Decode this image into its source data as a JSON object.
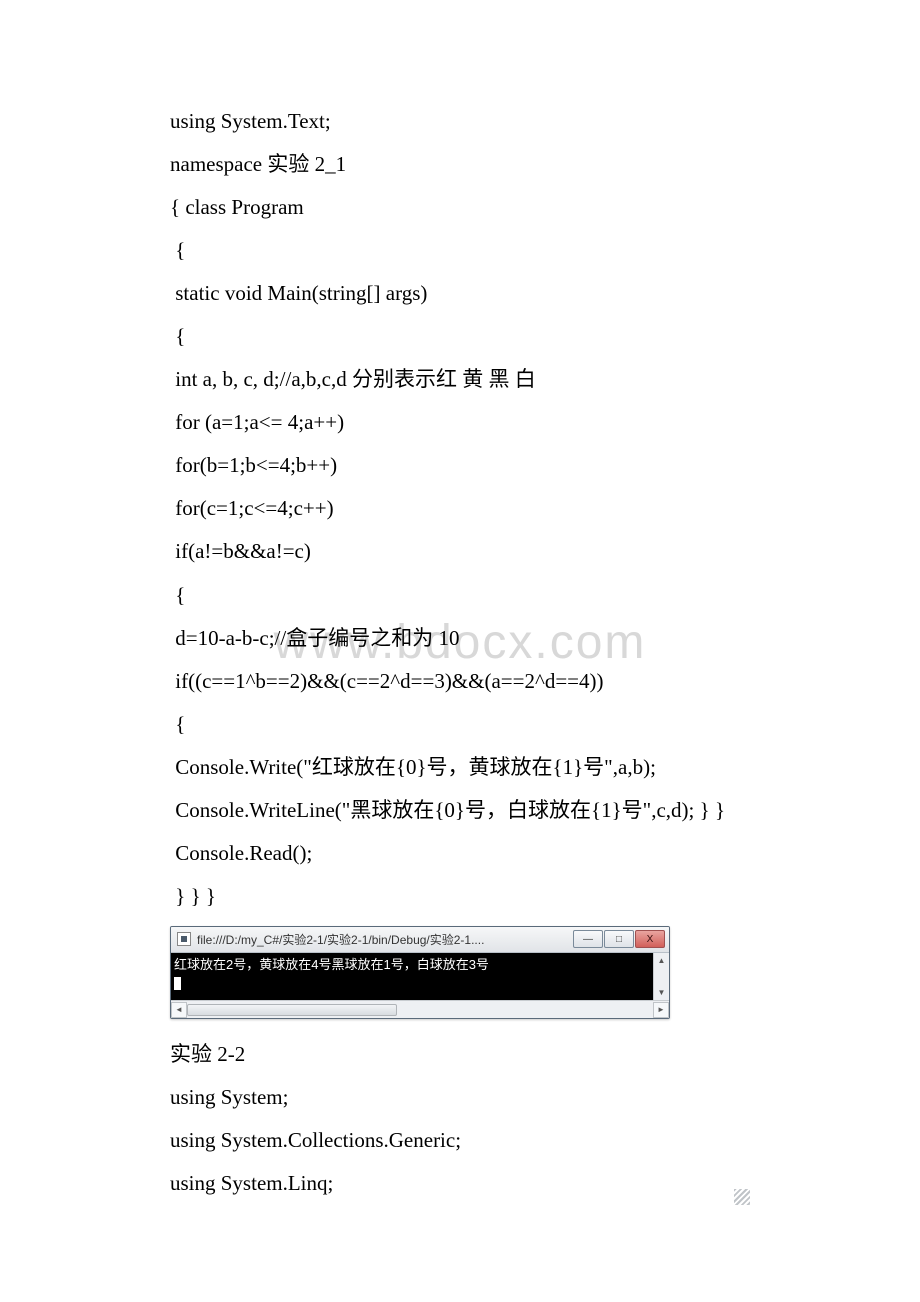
{
  "watermark": "www.bdocx.com",
  "code_block_1": [
    "using System.Text;",
    "namespace 实验 2_1",
    "{ class Program",
    " {",
    " static void Main(string[] args)",
    " {",
    " int a, b, c, d;//a,b,c,d 分别表示红 黄 黑 白",
    " for (a=1;a<= 4;a++)",
    " for(b=1;b<=4;b++)",
    " for(c=1;c<=4;c++)",
    " if(a!=b&&a!=c)",
    " {",
    " d=10-a-b-c;//盒子编号之和为 10",
    " if((c==1^b==2)&&(c==2^d==3)&&(a==2^d==4))",
    " {",
    " Console.Write(\"红球放在{0}号，黄球放在{1}号\",a,b);",
    " Console.WriteLine(\"黑球放在{0}号，白球放在{1}号\",c,d); } }",
    " Console.Read();",
    " } } }"
  ],
  "console": {
    "title": "file:///D:/my_C#/实验2-1/实验2-1/bin/Debug/实验2-1....",
    "output": "红球放在2号，黄球放在4号黑球放在1号，白球放在3号",
    "buttons": {
      "min": "—",
      "max": "□",
      "close": "X"
    }
  },
  "section_2_title": " 实验 2-2",
  "code_block_2": [
    "using System;",
    "using System.Collections.Generic;",
    "using System.Linq;"
  ]
}
